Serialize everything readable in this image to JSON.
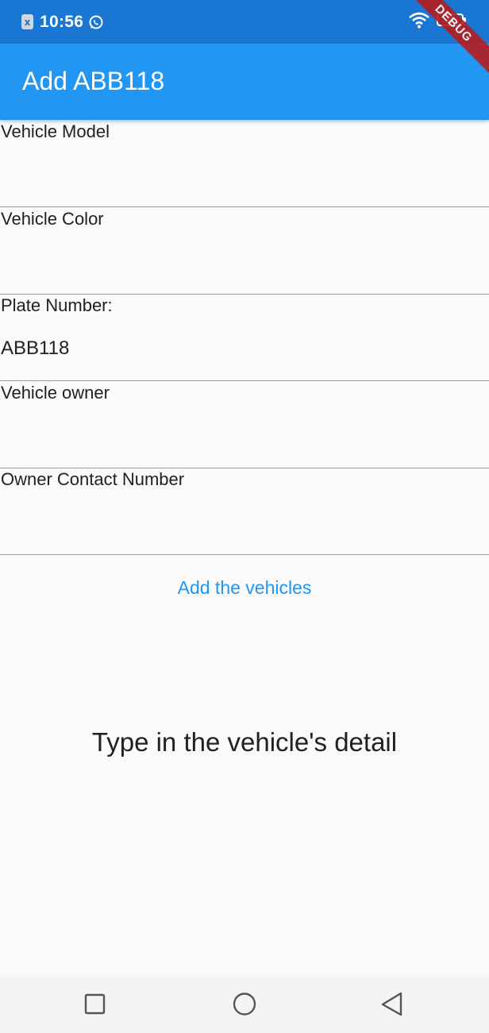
{
  "status_bar": {
    "time": "10:56",
    "battery_level": "11",
    "icons": [
      "app-notification-icon",
      "whatsapp-icon",
      "wifi-icon",
      "battery-icon"
    ]
  },
  "app_bar": {
    "title": "Add ABB118",
    "background": "#2196f3",
    "debug_label": "DEBUG"
  },
  "form": {
    "fields": [
      {
        "label": "Vehicle Model",
        "value": ""
      },
      {
        "label": "Vehicle Color",
        "value": ""
      },
      {
        "label": "Plate Number:",
        "value": "ABB118"
      },
      {
        "label": "Vehicle owner",
        "value": ""
      },
      {
        "label": "Owner Contact Number",
        "value": ""
      }
    ],
    "submit_label": "Add the vehicles"
  },
  "message": "Type in the vehicle's detail",
  "nav_bar": {
    "buttons": [
      "recents-icon",
      "home-icon",
      "back-icon"
    ]
  }
}
